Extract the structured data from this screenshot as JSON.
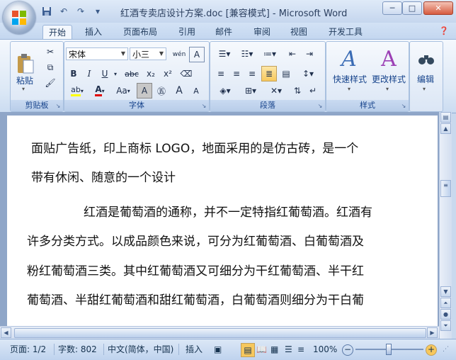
{
  "window": {
    "title": "红酒专卖店设计方案.doc [兼容模式] - Microsoft Word",
    "minimize": "─",
    "maximize": "□",
    "close": "✕"
  },
  "qat": {
    "save": "💾",
    "undo": "↶",
    "redo": "↷",
    "more": "▾"
  },
  "tabs": [
    "开始",
    "插入",
    "页面布局",
    "引用",
    "邮件",
    "审阅",
    "视图",
    "开发工具"
  ],
  "ribbon": {
    "clipboard": {
      "label": "剪贴板",
      "paste": "粘贴"
    },
    "font": {
      "label": "字体",
      "font_name": "宋体",
      "font_size": "小三",
      "bold": "B",
      "italic": "I",
      "underline": "U",
      "strike": "abc",
      "subscript": "x₂",
      "superscript": "x²",
      "color_a": "A",
      "case": "Aa",
      "grow": "A",
      "shrink": "A"
    },
    "paragraph": {
      "label": "段落"
    },
    "styles": {
      "label": "样式",
      "quick": "快速样式",
      "change": "更改样式"
    },
    "edit": {
      "label": "编辑"
    }
  },
  "document": {
    "lines": [
      "面贴广告纸，印上商标 LOGO，地面采用的是仿古砖，是一个",
      "带有休闲、随意的一个设计",
      "红酒是葡萄酒的通称，并不一定特指红葡萄酒。红酒有",
      "许多分类方式。以成品颜色来说，可分为红葡萄酒、白葡萄酒及",
      "粉红葡萄酒三类。其中红葡萄酒又可细分为干红葡萄酒、半干红",
      "葡萄酒、半甜红葡萄酒和甜红葡萄酒，白葡萄酒则细分为干白葡"
    ]
  },
  "status": {
    "page": "页面: 1/2",
    "words": "字数: 802",
    "language": "中文(简体，中国)",
    "mode": "插入",
    "zoom": "100%",
    "zoom_level": 1.0
  },
  "colors": {
    "accent": "#15428b",
    "highlight": "#ffff00",
    "font_color": "#e00000"
  }
}
